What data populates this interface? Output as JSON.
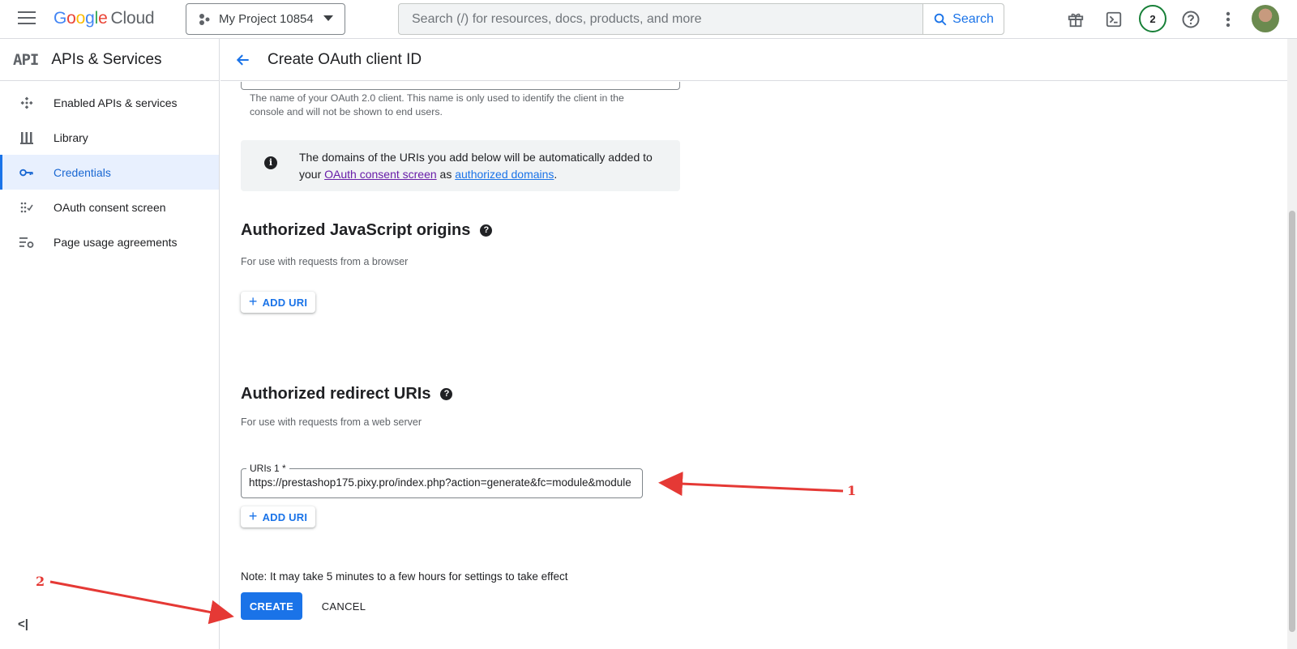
{
  "topbar": {
    "logo_google": "Google",
    "logo_cloud": "Cloud",
    "project_name": "My Project 10854",
    "search_placeholder": "Search (/) for resources, docs, products, and more",
    "search_button": "Search",
    "notifications_count": "2"
  },
  "sidebar": {
    "product_icon": "API",
    "title": "APIs & Services",
    "items": [
      {
        "label": "Enabled APIs & services",
        "icon": "enabled-apis-icon"
      },
      {
        "label": "Library",
        "icon": "library-icon"
      },
      {
        "label": "Credentials",
        "icon": "key-icon",
        "active": true
      },
      {
        "label": "OAuth consent screen",
        "icon": "oauth-consent-icon"
      },
      {
        "label": "Page usage agreements",
        "icon": "settings-list-icon"
      }
    ],
    "collapse_label": "<|"
  },
  "header": {
    "title": "Create OAuth client ID"
  },
  "form": {
    "name_hint": "The name of your OAuth 2.0 client. This name is only used to identify the client in the console and will not be shown to end users.",
    "info": {
      "text_before": "The domains of the URIs you add below will be automatically added to your",
      "link1": "OAuth consent screen",
      "text_mid": "as",
      "link2": "authorized domains",
      "text_end": "."
    },
    "js_origins": {
      "title": "Authorized JavaScript origins",
      "subtitle": "For use with requests from a browser",
      "add_label": "ADD URI"
    },
    "redirect_uris": {
      "title": "Authorized redirect URIs",
      "subtitle": "For use with requests from a web server",
      "field_label": "URIs 1 *",
      "field_value": "https://prestashop175.pixy.pro/index.php?action=generate&fc=module&module",
      "add_label": "ADD URI"
    },
    "note": "Note: It may take 5 minutes to a few hours for settings to take effect",
    "create_label": "CREATE",
    "cancel_label": "CANCEL"
  },
  "annotations": {
    "marker1": "1",
    "marker2": "2",
    "color": "#e53935"
  },
  "colors": {
    "accent": "#1a73e8",
    "active_bg": "#e8f0fe",
    "status_green": "#188038"
  }
}
